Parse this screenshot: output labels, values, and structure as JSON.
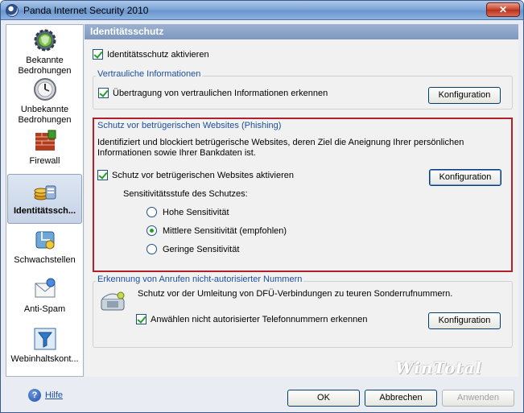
{
  "window": {
    "title": "Panda Internet Security 2010",
    "close": "✕"
  },
  "sidebar": {
    "items": [
      {
        "label": "Bekannte Bedrohungen",
        "icon": "gear-shield-icon"
      },
      {
        "label": "Unbekannte Bedrohungen",
        "icon": "clock-icon"
      },
      {
        "label": "Firewall",
        "icon": "firewall-icon"
      },
      {
        "label": "Identitätssch...",
        "icon": "coins-icon"
      },
      {
        "label": "Schwachstellen",
        "icon": "puzzle-icon"
      },
      {
        "label": "Anti-Spam",
        "icon": "envelope-icon"
      },
      {
        "label": "Webinhaltskont...",
        "icon": "filter-icon"
      }
    ]
  },
  "header": {
    "title": "Identitätsschutz"
  },
  "main": {
    "enable_label": "Identitätsschutz aktivieren",
    "confidential": {
      "title": "Vertrauliche Informationen",
      "checkbox_label": "Übertragung von vertraulichen Informationen erkennen",
      "button": "Konfiguration"
    },
    "phishing": {
      "title": "Schutz vor betrügerischen Websites (Phishing)",
      "description_line1": "Identifiziert und blockiert betrügerische Websites, deren Ziel die Aneignung Ihrer persönlichen",
      "description_line2": "Informationen sowie Ihrer Bankdaten ist.",
      "checkbox_label": "Schutz vor betrügerischen Websites aktivieren",
      "button": "Konfiguration",
      "sensitivity_label": "Sensitivitätsstufe des Schutzes:",
      "options": [
        "Hohe Sensitivität",
        "Mittlere Sensitivität (empfohlen)",
        "Geringe Sensitivität"
      ],
      "selected": "Mittlere Sensitivität (empfohlen)"
    },
    "dialer": {
      "title": "Erkennung von Anrufen nicht-autorisierter Nummern",
      "description": "Schutz vor der Umleitung von DFÜ-Verbindungen zu teuren Sonderrufnummern.",
      "checkbox_label": "Anwählen nicht autorisierter Telefonnummern erkennen",
      "button": "Konfiguration"
    }
  },
  "footer": {
    "help_icon": "?",
    "help": "Hilfe",
    "ok": "OK",
    "cancel": "Abbrechen",
    "apply": "Anwenden"
  },
  "watermark": "WinTotal"
}
